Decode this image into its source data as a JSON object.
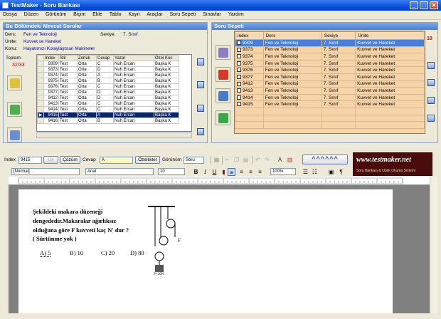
{
  "window": {
    "title": "TestMaker - Soru Bankası"
  },
  "menu": [
    "Dosya",
    "Düzen",
    "Görünüm",
    "Biçim",
    "Ekle",
    "Tablo",
    "Kayıt",
    "Araçlar",
    "Soru Sepeti",
    "Sınavlar",
    "Yardım"
  ],
  "left_panel": {
    "title": "Bu Bölümdeki Mevcut Sorular",
    "ders_label": "Ders:",
    "ders_value": "Fen ve Teknoloji",
    "seviye_label": "Seviye:",
    "seviye_value": "7. Sınıf",
    "unite_label": "Ünite:",
    "unite_value": "Kuvvet ve Hareket",
    "konu_label": "Konu:",
    "konu_value": "Hayatımızı Kolaylaştıran Makineler",
    "toplam_label": "Toplam:",
    "toplam_value": "32/33",
    "columns": [
      "",
      "Index",
      "Stil",
      "Zorluk",
      "Cevap",
      "Yazar",
      "Özel Koc"
    ],
    "rows": [
      [
        "",
        "9309",
        "Test",
        "Orta",
        "C",
        "Nuh Ercan",
        "Başka K"
      ],
      [
        "",
        "9373",
        "Test",
        "Orta",
        "D",
        "Nuh Ercan",
        "Başka K"
      ],
      [
        "",
        "9374",
        "Test",
        "Orta",
        "A",
        "Nuh Ercan",
        "Başka K"
      ],
      [
        "",
        "9375",
        "Test",
        "Orta",
        "B",
        "Nuh Ercan",
        "Başka K"
      ],
      [
        "",
        "9376",
        "Test",
        "Orta",
        "C",
        "Nuh Ercan",
        "Başka K"
      ],
      [
        "",
        "9377",
        "Test",
        "Orta",
        "D",
        "Nuh Ercan",
        "Başka K"
      ],
      [
        "",
        "9412",
        "Test",
        "Orta",
        "D",
        "Nuh Ercan",
        "Başka K"
      ],
      [
        "",
        "9413",
        "Test",
        "Orta",
        "C",
        "Nuh Ercan",
        "Başka K"
      ],
      [
        "",
        "9414",
        "Test",
        "Orta",
        "C",
        "Nuh Ercan",
        "Başka K"
      ],
      [
        "▶",
        "9415",
        "Test",
        "Orta",
        "A",
        "Nuh Ercan",
        "Başka K"
      ],
      [
        "",
        "9416",
        "Test",
        "Orta",
        "B",
        "Nuh Ercan",
        "Başka K"
      ]
    ]
  },
  "right_panel": {
    "title": "Soru Sepeti",
    "count": "10",
    "columns": [
      "index",
      "Ders",
      "Seviye",
      "Ünite"
    ],
    "rows": [
      [
        "9309",
        "Fen ve Teknoloji",
        "7. Sınıf",
        "Kuvvet ve Hareket"
      ],
      [
        "9373",
        "Fen ve Teknoloji",
        "7. Sınıf",
        "Kuvvet ve Hareket"
      ],
      [
        "9374",
        "Fen ve Teknoloji",
        "7. Sınıf",
        "Kuvvet ve Hareket"
      ],
      [
        "9375",
        "Fen ve Teknoloji",
        "7. Sınıf",
        "Kuvvet ve Hareket"
      ],
      [
        "9376",
        "Fen ve Teknoloji",
        "7. Sınıf",
        "Kuvvet ve Hareket"
      ],
      [
        "9377",
        "Fen ve Teknoloji",
        "7. Sınıf",
        "Kuvvet ve Hareket"
      ],
      [
        "9412",
        "Fen ve Teknoloji",
        "7. Sınıf",
        "Kuvvet ve Hareket"
      ],
      [
        "9413",
        "Fen ve Teknoloji",
        "7. Sınıf",
        "Kuvvet ve Hareket"
      ],
      [
        "9414",
        "Fen ve Teknoloji",
        "7. Sınıf",
        "Kuvvet ve Hareket"
      ],
      [
        "9415",
        "Fen ve Teknoloji",
        "7. Sınıf",
        "Kuvvet ve Hareket"
      ]
    ]
  },
  "toolbar": {
    "index_label": "İndex",
    "index_value": "9415",
    "git_label": "Git",
    "cozum_label": "Çözüm",
    "cevap_label": "Cevap",
    "cevap_value": "A",
    "ozellikler_label": "Özellikler",
    "gorunum_label": "Görünüm",
    "gorunum_value": "Soru",
    "arrows_label": "^^^^^^",
    "style_value": "[Normal]",
    "font_value": "Arial",
    "size_value": "10",
    "zoom_value": "100%",
    "brand_url": "www.testmaker.net",
    "brand_sub": "Soru Bankası & Optik Okuma Sistemi"
  },
  "question": {
    "line1": "Şekildeki makara düzeneği",
    "line2": "dengededir.Makaralar ağırlıksız",
    "line3": "olduğuna göre F kuvveti kaç N' dur ?",
    "line4": "( Sürtünme yok )",
    "options": [
      "A) 5",
      "B) 10",
      "C) 20",
      "D) 80"
    ],
    "force_label": "F",
    "weight_label": "P=20N"
  }
}
